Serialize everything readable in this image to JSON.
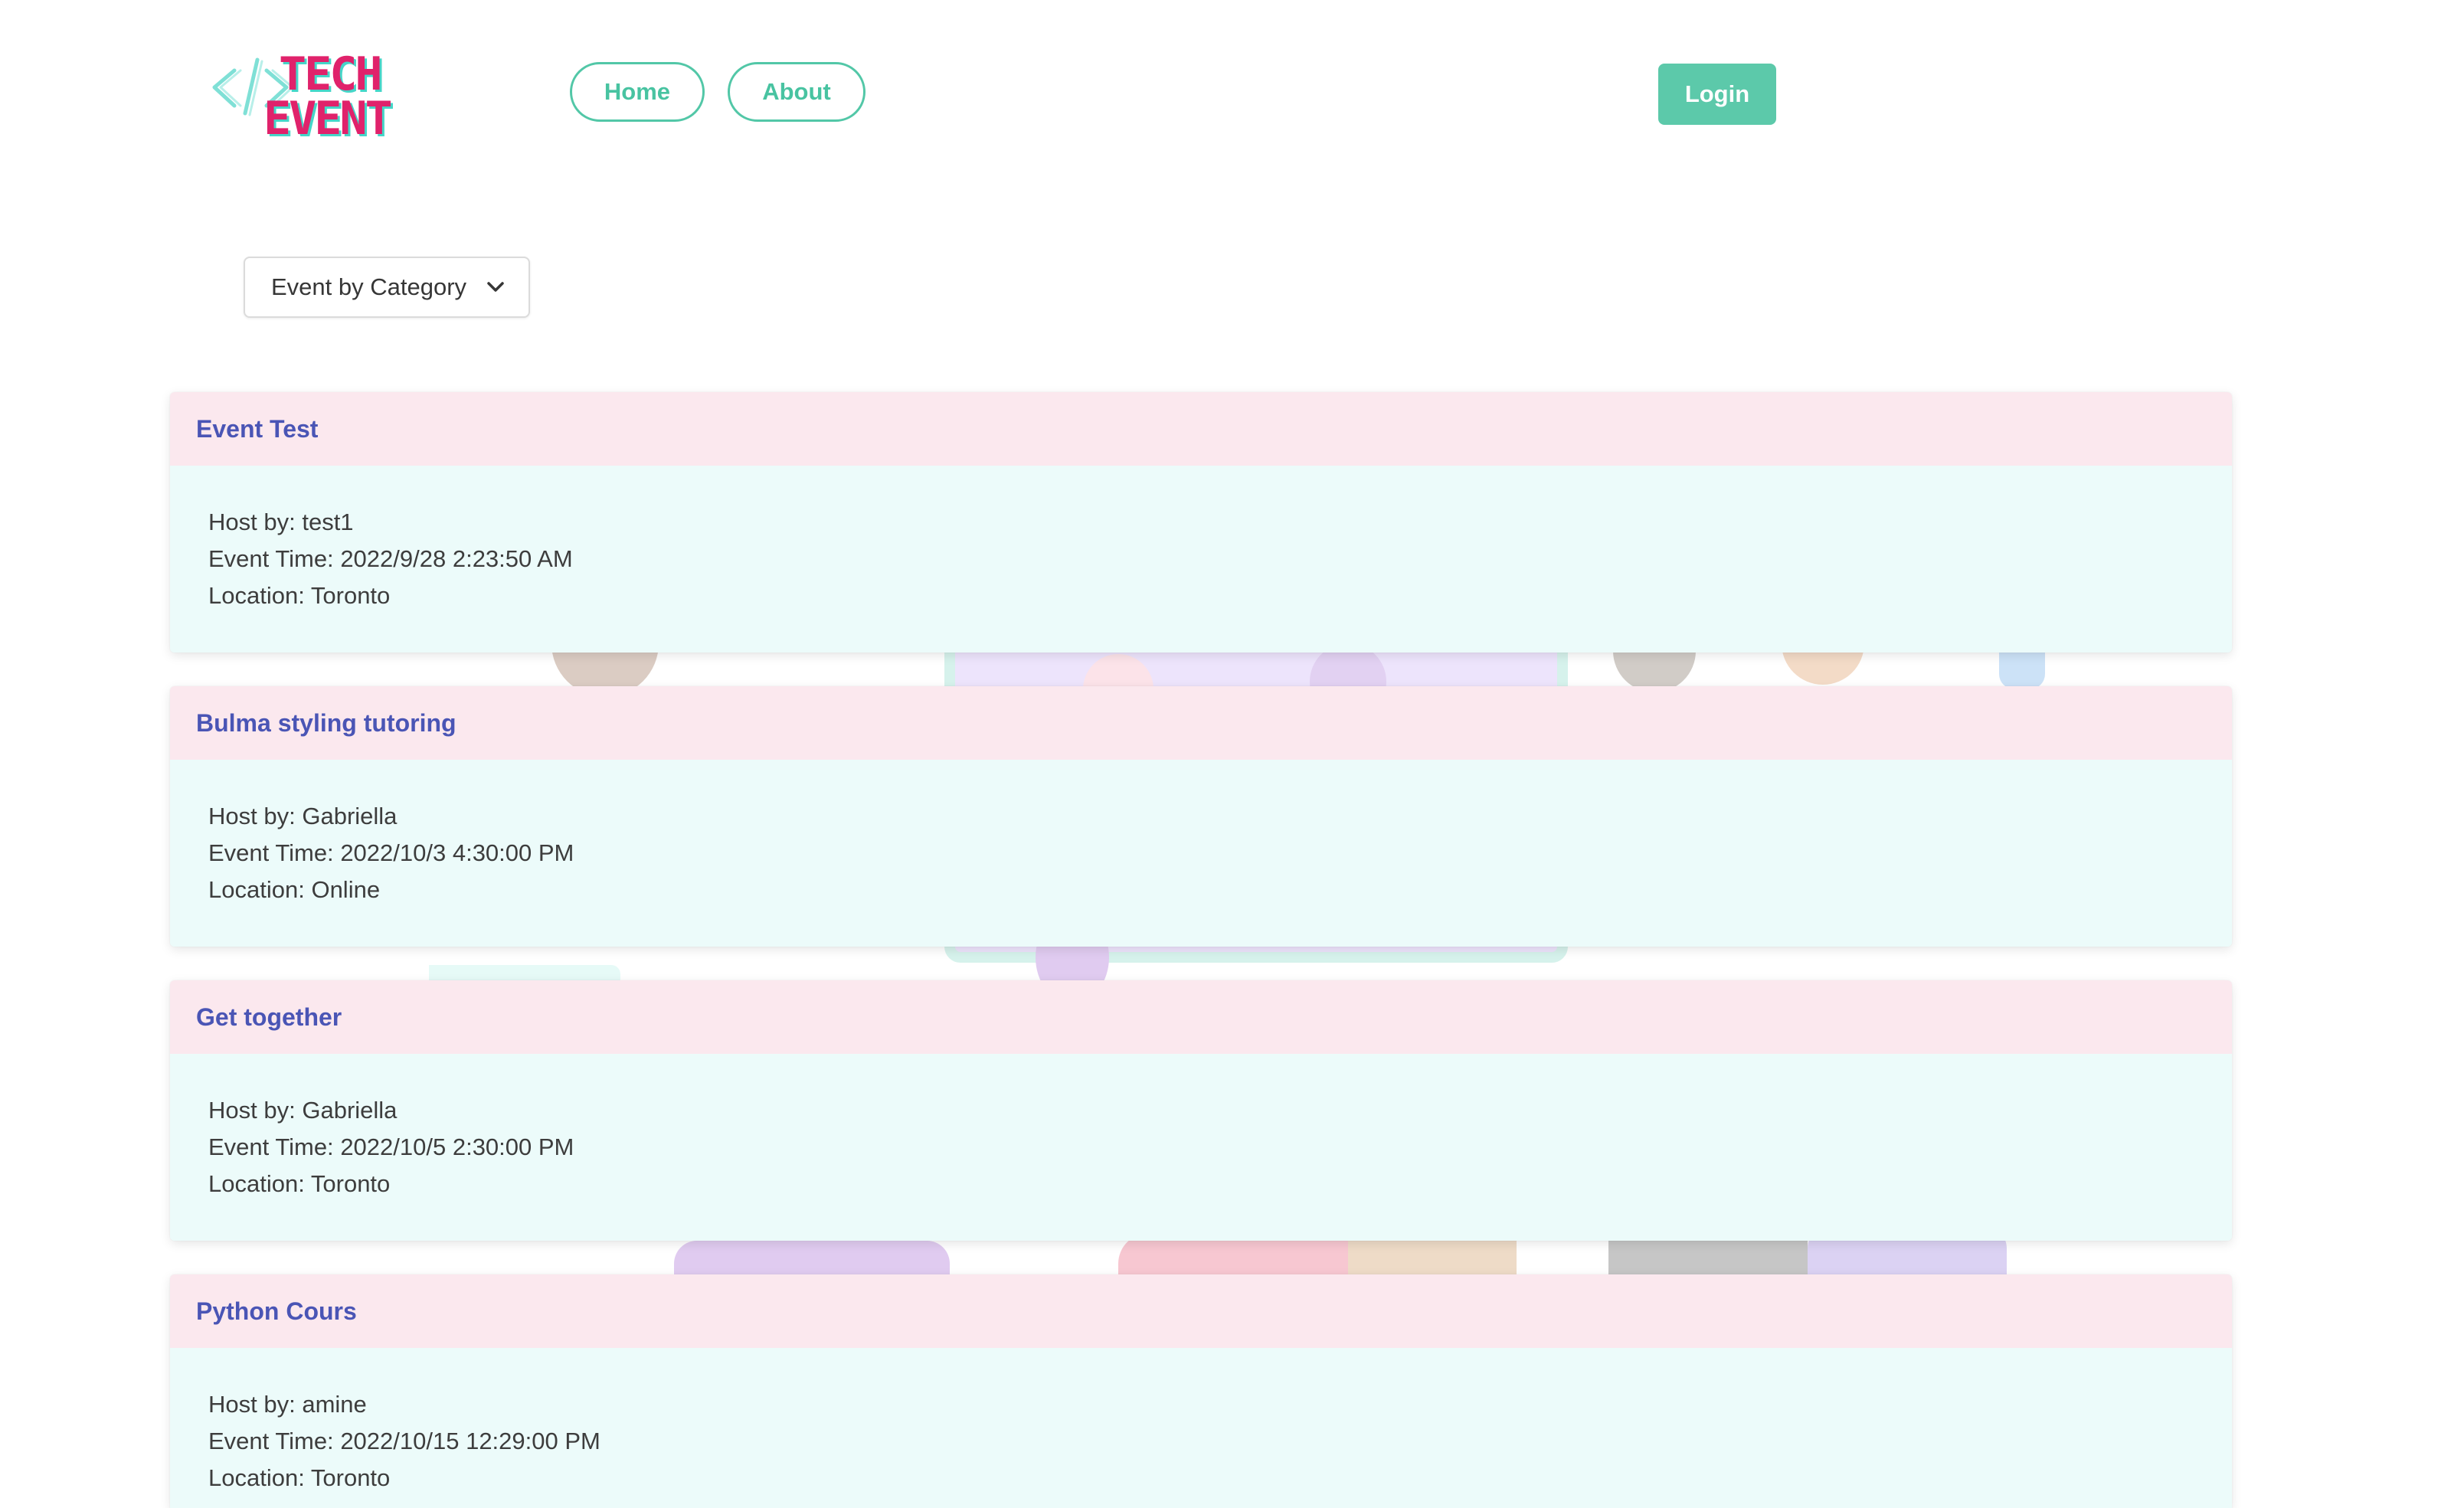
{
  "brand": {
    "logo_line1": "TECH",
    "logo_line2": "EVENT",
    "colors": {
      "primary": "#52c7a7",
      "logo": "#e0226b",
      "logo_outline": "#45d6c8",
      "card_title": "#4a55b5",
      "card_header_bg": "#fbe8ee",
      "card_body_bg": "#ecfbfa"
    }
  },
  "nav": {
    "home_label": "Home",
    "about_label": "About",
    "login_label": "Login"
  },
  "filter": {
    "selected": "Event by Category",
    "icon": "chevron-down-icon"
  },
  "events": [
    {
      "title": "Event Test",
      "host_label": "Host by:",
      "host": "test1",
      "time_label": "Event Time:",
      "time": "2022/9/28 2:23:50 AM",
      "location_label": "Location:",
      "location": "Toronto"
    },
    {
      "title": "Bulma styling tutoring",
      "host_label": "Host by:",
      "host": "Gabriella",
      "time_label": "Event Time:",
      "time": "2022/10/3 4:30:00 PM",
      "location_label": "Location:",
      "location": "Online"
    },
    {
      "title": "Get together",
      "host_label": "Host by:",
      "host": "Gabriella",
      "time_label": "Event Time:",
      "time": "2022/10/5 2:30:00 PM",
      "location_label": "Location:",
      "location": "Toronto"
    },
    {
      "title": "Python Cours",
      "host_label": "Host by:",
      "host": "amine",
      "time_label": "Event Time:",
      "time": "2022/10/15 12:29:00 PM",
      "location_label": "Location:",
      "location": "Toronto"
    }
  ]
}
